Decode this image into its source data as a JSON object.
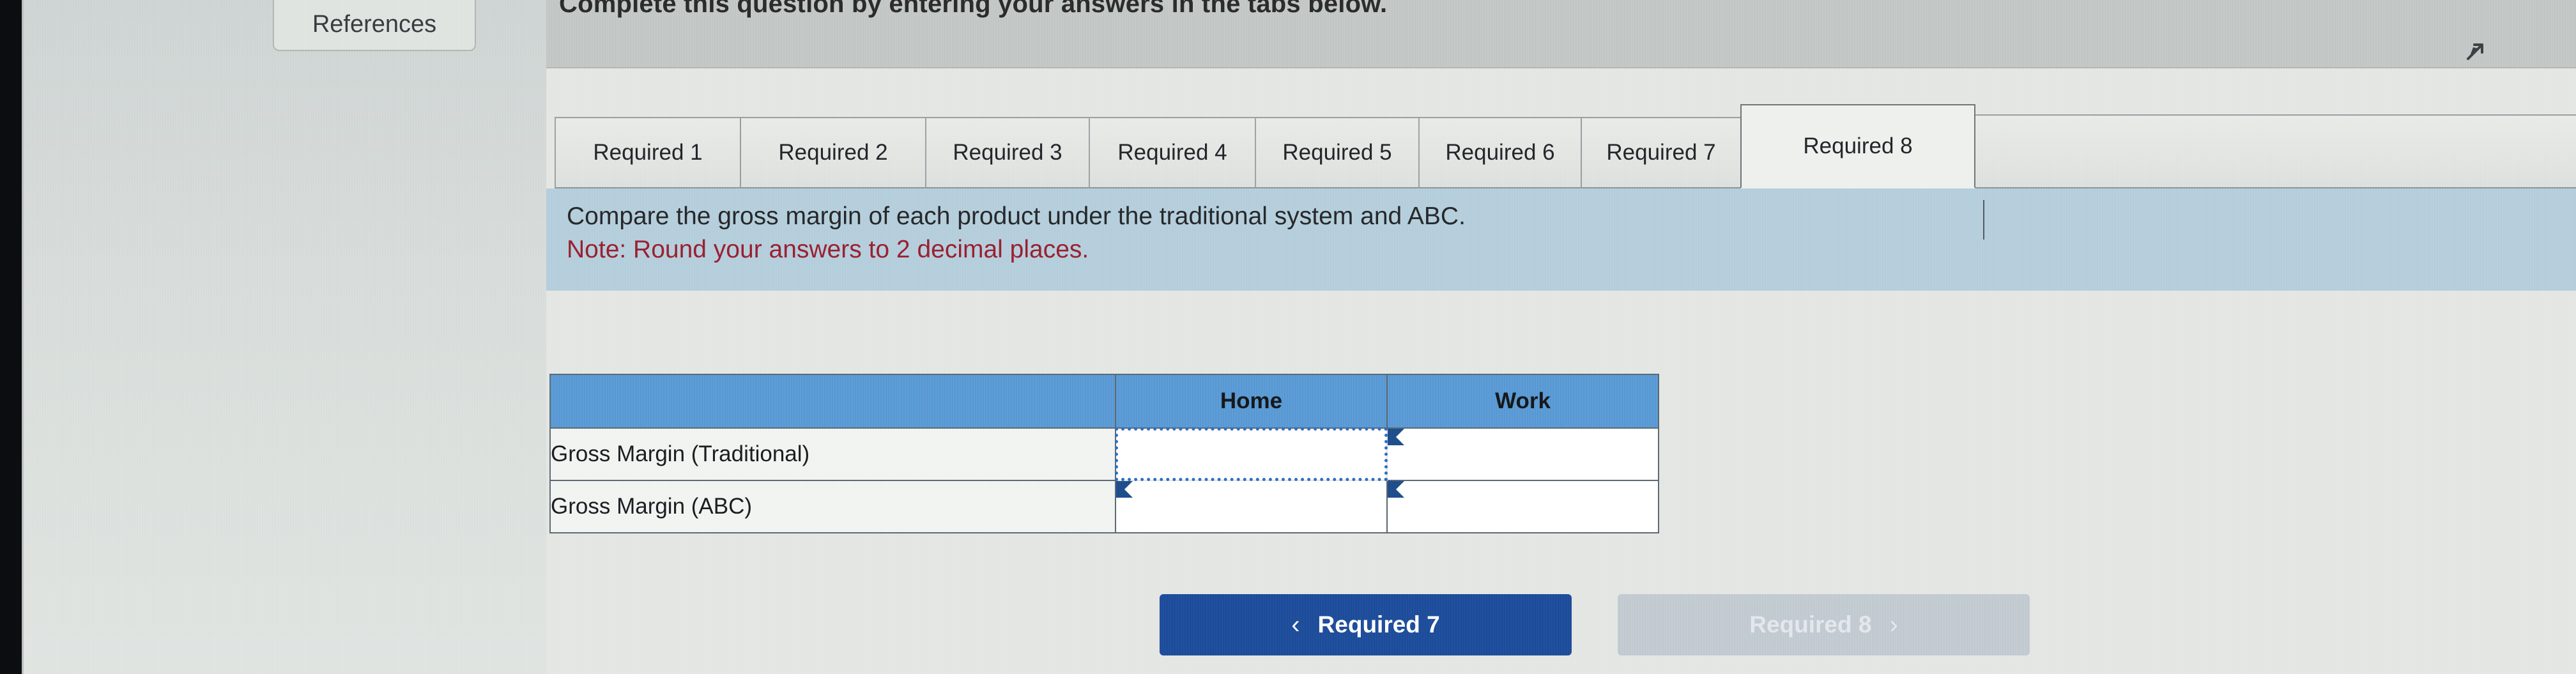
{
  "window": {
    "header_instruction": "Complete this question by entering your answers in the tabs below.",
    "expand_icon": "expand-arrow-icon"
  },
  "left_pane": {
    "references_label": "References"
  },
  "tabs": {
    "items": [
      {
        "label": "Required 1",
        "active": false
      },
      {
        "label": "Required 2",
        "active": false
      },
      {
        "label": "Required 3",
        "active": false
      },
      {
        "label": "Required 4",
        "active": false
      },
      {
        "label": "Required 5",
        "active": false
      },
      {
        "label": "Required 6",
        "active": false
      },
      {
        "label": "Required 7",
        "active": false
      },
      {
        "label": "Required 8",
        "active": true
      }
    ],
    "active_index": 7
  },
  "instructions": {
    "line_1": "Compare the gross margin of each product under the traditional system and ABC.",
    "note": "Note: Round your answers to 2 decimal places."
  },
  "table": {
    "headers": [
      "",
      "Home",
      "Work"
    ],
    "rows": [
      {
        "label": "Gross Margin (Traditional)",
        "home": "",
        "work": ""
      },
      {
        "label": "Gross Margin (ABC)",
        "home": "",
        "work": ""
      }
    ],
    "cell_placeholder": "",
    "focused_cell": "row0-home",
    "header_bg": "#5b9bd5",
    "border_color": "#5d6a75",
    "marker_color": "#1f4e8c",
    "focus_color": "#2f6fbf"
  },
  "nav": {
    "prev_label": "Required 7",
    "prev_icon": "chevron-left-icon",
    "prev_color": "#1f4e9c",
    "next_label": "Required 8",
    "next_icon": "chevron-right-icon",
    "next_color": "#c3cbd2",
    "next_disabled": true
  },
  "colors": {
    "instruction_panel_bg": "#b6cfdd",
    "note_text": "#9b2030",
    "page_bg": "#d8dddb",
    "card_bg": "#e4e7e3",
    "header_band_bg": "#c3c7c5"
  }
}
